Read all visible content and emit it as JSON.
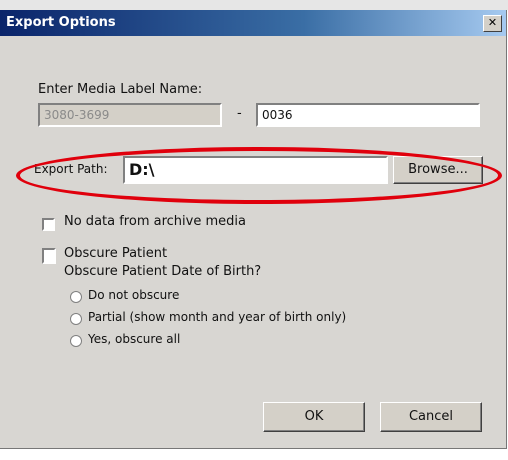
{
  "window": {
    "title": "Export Options",
    "close_glyph": "✕"
  },
  "top_strip": {
    "text": ""
  },
  "media_label": {
    "label": "Enter Media Label Name:",
    "prefix_value": "3080-3699",
    "separator": "-",
    "suffix_value": "0036"
  },
  "export_path": {
    "label": "Export Path:",
    "value": "D:\\",
    "browse_label": "Browse..."
  },
  "options": {
    "no_archive_label": "No data from archive media",
    "obscure_patient_label": "Obscure Patient",
    "obscure_dob_question": "Obscure Patient Date of Birth?",
    "dob_choices": [
      "Do not obscure",
      "Partial (show month and year of birth only)",
      "Yes, obscure all"
    ]
  },
  "buttons": {
    "ok": "OK",
    "cancel": "Cancel"
  },
  "colors": {
    "highlight": "#e0000c",
    "title_start": "#0a246a",
    "title_end": "#a6caf0",
    "dialog_bg": "#d8d6d2"
  }
}
